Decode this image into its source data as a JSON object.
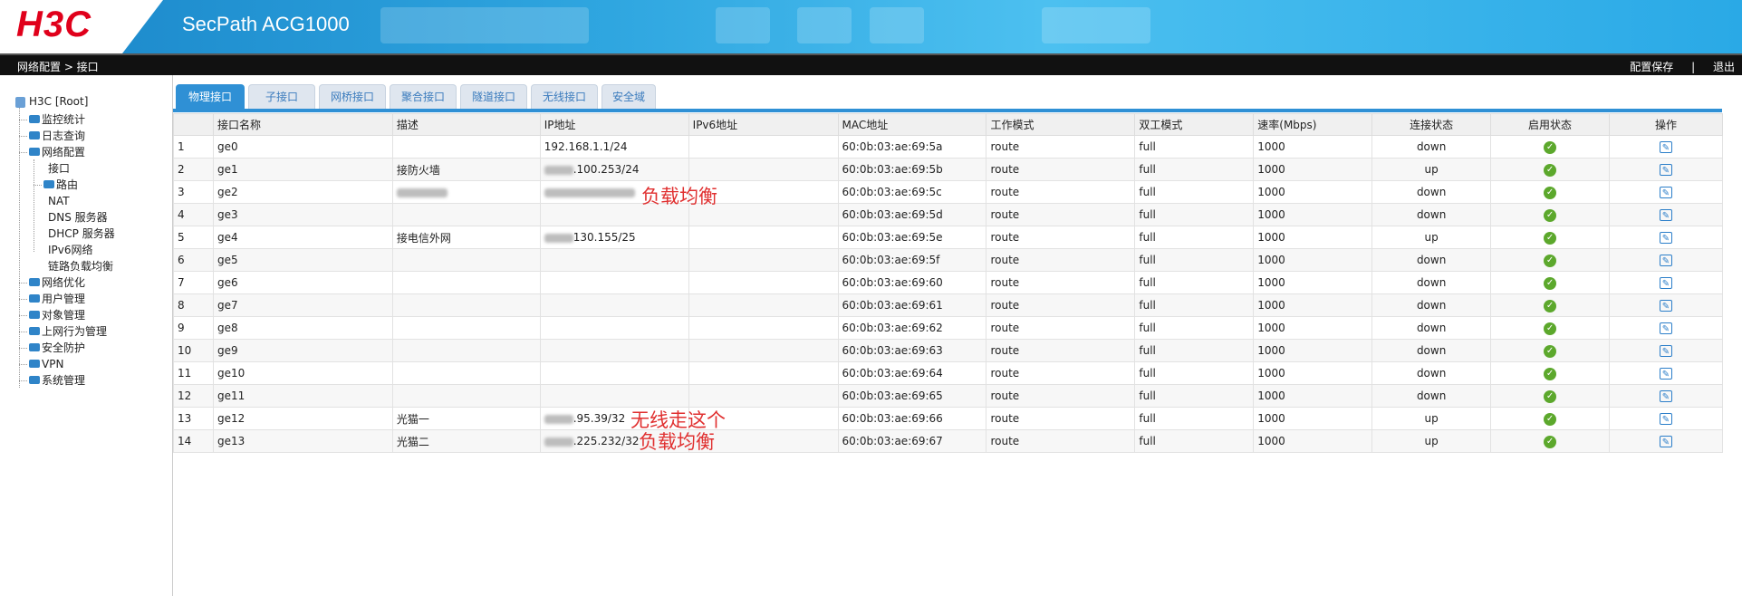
{
  "header": {
    "logo": "H3C",
    "product": "SecPath ACG1000"
  },
  "navbar": {
    "breadcrumb": "网络配置 > 接口",
    "save": "配置保存",
    "sep": "|",
    "logout": "退出"
  },
  "sidebar": {
    "root": "H3C [Root]",
    "items": [
      "监控统计",
      "日志查询",
      "网络配置",
      "接口",
      "路由",
      "NAT",
      "DNS 服务器",
      "DHCP 服务器",
      "IPv6网络",
      "链路负载均衡",
      "网络优化",
      "用户管理",
      "对象管理",
      "上网行为管理",
      "安全防护",
      "VPN",
      "系统管理"
    ]
  },
  "tabs": [
    "物理接口",
    "子接口",
    "网桥接口",
    "聚合接口",
    "隧道接口",
    "无线接口",
    "安全域"
  ],
  "table": {
    "headers": [
      "",
      "接口名称",
      "描述",
      "IP地址",
      "IPv6地址",
      "MAC地址",
      "工作模式",
      "双工模式",
      "速率(Mbps)",
      "连接状态",
      "启用状态",
      "操作"
    ],
    "rows": [
      {
        "n": "1",
        "name": "ge0",
        "desc": "",
        "ip": "192.168.1.1/24",
        "mac": "60:0b:03:ae:69:5a",
        "mode": "route",
        "duplex": "full",
        "rate": "1000",
        "link": "down"
      },
      {
        "n": "2",
        "name": "ge1",
        "desc": "接防火墙",
        "ip": ".100.253/24",
        "mac": "60:0b:03:ae:69:5b",
        "mode": "route",
        "duplex": "full",
        "rate": "1000",
        "link": "up"
      },
      {
        "n": "3",
        "name": "ge2",
        "desc": "",
        "ip": "",
        "mac": "60:0b:03:ae:69:5c",
        "mode": "route",
        "duplex": "full",
        "rate": "1000",
        "link": "down"
      },
      {
        "n": "4",
        "name": "ge3",
        "desc": "",
        "ip": "",
        "mac": "60:0b:03:ae:69:5d",
        "mode": "route",
        "duplex": "full",
        "rate": "1000",
        "link": "down"
      },
      {
        "n": "5",
        "name": "ge4",
        "desc": "接电信外网",
        "ip": "130.155/25",
        "mac": "60:0b:03:ae:69:5e",
        "mode": "route",
        "duplex": "full",
        "rate": "1000",
        "link": "up"
      },
      {
        "n": "6",
        "name": "ge5",
        "desc": "",
        "ip": "",
        "mac": "60:0b:03:ae:69:5f",
        "mode": "route",
        "duplex": "full",
        "rate": "1000",
        "link": "down"
      },
      {
        "n": "7",
        "name": "ge6",
        "desc": "",
        "ip": "",
        "mac": "60:0b:03:ae:69:60",
        "mode": "route",
        "duplex": "full",
        "rate": "1000",
        "link": "down"
      },
      {
        "n": "8",
        "name": "ge7",
        "desc": "",
        "ip": "",
        "mac": "60:0b:03:ae:69:61",
        "mode": "route",
        "duplex": "full",
        "rate": "1000",
        "link": "down"
      },
      {
        "n": "9",
        "name": "ge8",
        "desc": "",
        "ip": "",
        "mac": "60:0b:03:ae:69:62",
        "mode": "route",
        "duplex": "full",
        "rate": "1000",
        "link": "down"
      },
      {
        "n": "10",
        "name": "ge9",
        "desc": "",
        "ip": "",
        "mac": "60:0b:03:ae:69:63",
        "mode": "route",
        "duplex": "full",
        "rate": "1000",
        "link": "down"
      },
      {
        "n": "11",
        "name": "ge10",
        "desc": "",
        "ip": "",
        "mac": "60:0b:03:ae:69:64",
        "mode": "route",
        "duplex": "full",
        "rate": "1000",
        "link": "down"
      },
      {
        "n": "12",
        "name": "ge11",
        "desc": "",
        "ip": "",
        "mac": "60:0b:03:ae:69:65",
        "mode": "route",
        "duplex": "full",
        "rate": "1000",
        "link": "down"
      },
      {
        "n": "13",
        "name": "ge12",
        "desc": "光猫一",
        "ip": ".95.39/32",
        "mac": "60:0b:03:ae:69:66",
        "mode": "route",
        "duplex": "full",
        "rate": "1000",
        "link": "up"
      },
      {
        "n": "14",
        "name": "ge13",
        "desc": "光猫二",
        "ip": ".225.232/32",
        "mac": "60:0b:03:ae:69:67",
        "mode": "route",
        "duplex": "full",
        "rate": "1000",
        "link": "up"
      }
    ]
  },
  "notes": {
    "ge4": "负载均衡",
    "ge12": "无线走这个",
    "ge13": "负载均衡"
  },
  "colors": {
    "accent": "#2f90d5",
    "enabled": "#5ca82c",
    "annotation": "#e03030",
    "logo": "#e0001b"
  }
}
